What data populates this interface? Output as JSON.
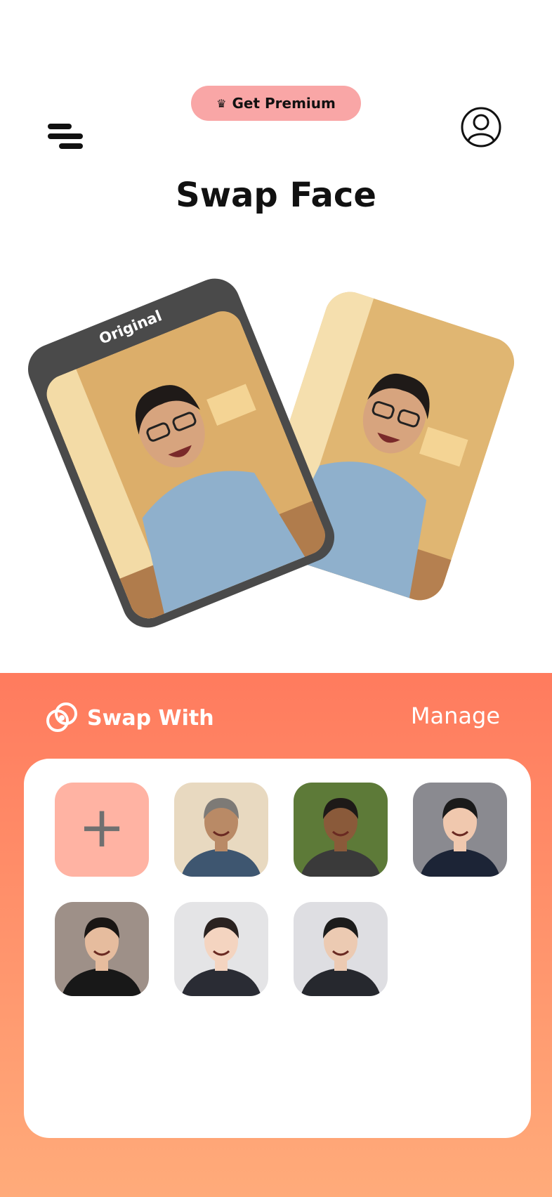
{
  "header": {
    "premium_label": "Get Premium",
    "premium_color": "#f9a6a6"
  },
  "page": {
    "title": "Swap Face"
  },
  "preview": {
    "original_label": "Original"
  },
  "swap_with": {
    "title": "Swap With",
    "manage_label": "Manage",
    "accent_color": "#ff7b5e",
    "faces": [
      {
        "name": "face-1",
        "bg": "#e8d9c0",
        "skin": "#b98a66",
        "hair": "#7d7a76",
        "shirt": "#3e5670"
      },
      {
        "name": "face-2",
        "bg": "#5d7a38",
        "skin": "#8a5a3a",
        "hair": "#1e1a18",
        "shirt": "#3a3a3a"
      },
      {
        "name": "face-3",
        "bg": "#8a8a90",
        "skin": "#f0c8ae",
        "hair": "#1a1a1a",
        "shirt": "#1c2436"
      },
      {
        "name": "face-4",
        "bg": "#9e9088",
        "skin": "#e6bc9e",
        "hair": "#1a1614",
        "shirt": "#181818"
      },
      {
        "name": "face-5",
        "bg": "#e4e4e6",
        "skin": "#f4d4c0",
        "hair": "#2a2220",
        "shirt": "#2a2c34"
      },
      {
        "name": "face-6",
        "bg": "#dedee2",
        "skin": "#eccab2",
        "hair": "#1c1c1c",
        "shirt": "#26282e"
      }
    ]
  }
}
